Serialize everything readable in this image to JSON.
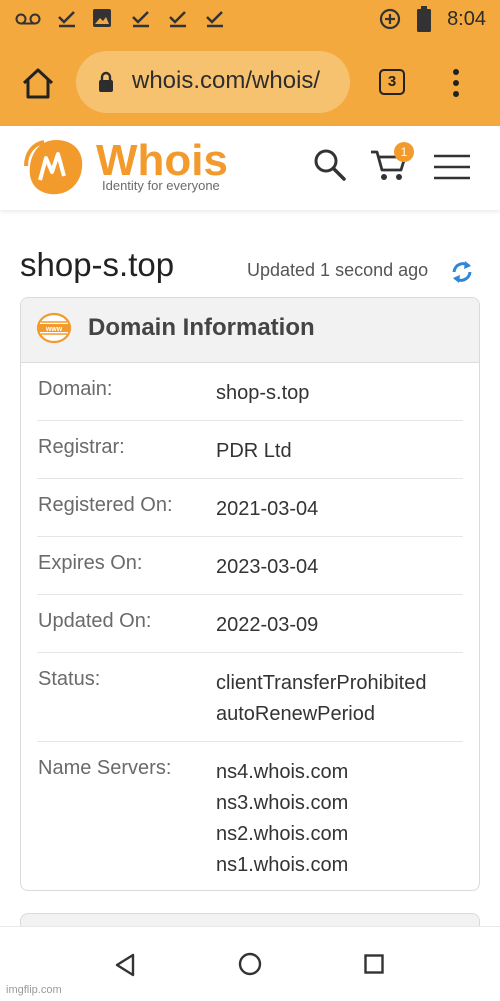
{
  "status_bar": {
    "time": "8:04",
    "icons": [
      "voicemail-icon",
      "check-icon",
      "image-icon",
      "check-icon",
      "check-icon",
      "check-icon",
      "data-saver-icon",
      "battery-icon"
    ]
  },
  "browser": {
    "url": "whois.com/whois/",
    "tab_count": "3",
    "accent_color": "#f3a93e"
  },
  "site": {
    "logo_text": "Whois",
    "tagline": "Identity for everyone",
    "cart_count": "1",
    "brand_color": "#f39a2c"
  },
  "page": {
    "domain": "shop-s.top",
    "updated": "Updated 1 second ago"
  },
  "card": {
    "title": "Domain Information",
    "rows": [
      {
        "label": "Domain:",
        "values": [
          "shop-s.top"
        ]
      },
      {
        "label": "Registrar:",
        "values": [
          "PDR Ltd"
        ]
      },
      {
        "label": "Registered On:",
        "values": [
          "2021-03-04"
        ]
      },
      {
        "label": "Expires On:",
        "values": [
          "2023-03-04"
        ]
      },
      {
        "label": "Updated On:",
        "values": [
          "2022-03-09"
        ]
      },
      {
        "label": "Status:",
        "values": [
          "clientTransferProhibited",
          "autoRenewPeriod"
        ]
      },
      {
        "label": "Name Servers:",
        "values": [
          "ns4.whois.com",
          "ns3.whois.com",
          "ns2.whois.com",
          "ns1.whois.com"
        ]
      }
    ]
  },
  "watermark": "imgflip.com"
}
